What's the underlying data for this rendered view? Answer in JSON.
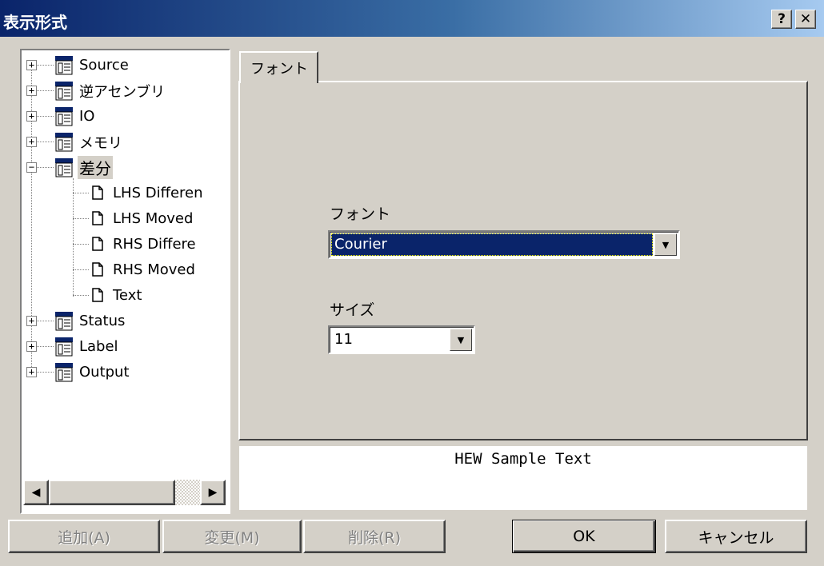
{
  "window": {
    "title": "表示形式",
    "help_label": "?",
    "close_label": "✕"
  },
  "tree": {
    "items": [
      {
        "label": "Source",
        "type": "folder",
        "expander": "+"
      },
      {
        "label": "逆アセンブリ",
        "type": "folder",
        "expander": "+"
      },
      {
        "label": "IO",
        "type": "folder",
        "expander": "+"
      },
      {
        "label": "メモリ",
        "type": "folder",
        "expander": "+"
      },
      {
        "label": "差分",
        "type": "folder",
        "expander": "−",
        "selected": true
      },
      {
        "label": "LHS Differen",
        "type": "document"
      },
      {
        "label": "LHS Moved",
        "type": "document"
      },
      {
        "label": "RHS Differe",
        "type": "document"
      },
      {
        "label": "RHS Moved",
        "type": "document"
      },
      {
        "label": "Text",
        "type": "document"
      },
      {
        "label": "Status",
        "type": "folder",
        "expander": "+"
      },
      {
        "label": "Label",
        "type": "folder",
        "expander": "+"
      },
      {
        "label": "Output",
        "type": "folder",
        "expander": "+"
      }
    ]
  },
  "tabs": [
    {
      "label": "フォント",
      "active": true
    }
  ],
  "font_field": {
    "label": "フォント",
    "value": "Courier"
  },
  "size_field": {
    "label": "サイズ",
    "value": "11"
  },
  "preview": {
    "text": "HEW Sample Text"
  },
  "buttons": {
    "add": "追加(A)",
    "change": "変更(M)",
    "delete": "削除(R)",
    "ok": "OK",
    "cancel": "キャンセル"
  },
  "colors": {
    "titlebar_start": "#0a246a",
    "titlebar_end": "#a6caf0",
    "face": "#d4d0c8",
    "selection": "#0a246a"
  },
  "icons": {
    "folder": "folder-icon",
    "document": "document-icon",
    "help": "help-icon",
    "close": "close-icon",
    "dropdown": "chevron-down-icon"
  }
}
